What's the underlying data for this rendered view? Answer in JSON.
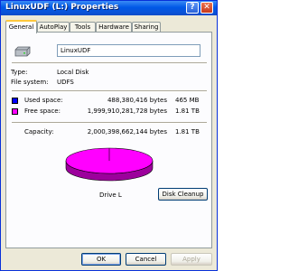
{
  "window": {
    "title": "LinuxUDF (L:) Properties",
    "help_glyph": "?",
    "close_glyph": "✕"
  },
  "tabs": [
    "General",
    "AutoPlay",
    "Tools",
    "Hardware",
    "Sharing"
  ],
  "general": {
    "volume_name": "LinuxUDF",
    "type_label": "Type:",
    "type_value": "Local Disk",
    "fs_label": "File system:",
    "fs_value": "UDFS",
    "used_label": "Used space:",
    "used_bytes": "488,380,416 bytes",
    "used_size": "465 MB",
    "free_label": "Free space:",
    "free_bytes": "1,999,910,281,728 bytes",
    "free_size": "1.81 TB",
    "capacity_label": "Capacity:",
    "capacity_bytes": "2,000,398,662,144 bytes",
    "capacity_size": "1.81 TB",
    "drive_label": "Drive L",
    "disk_cleanup_label": "Disk Cleanup",
    "used_fraction": 0.00024,
    "used_color": "#0000ff",
    "free_color": "#ff00ff"
  },
  "icons": {
    "drive": "hard-drive-icon"
  },
  "buttons": {
    "ok": "OK",
    "cancel": "Cancel",
    "apply": "Apply"
  }
}
